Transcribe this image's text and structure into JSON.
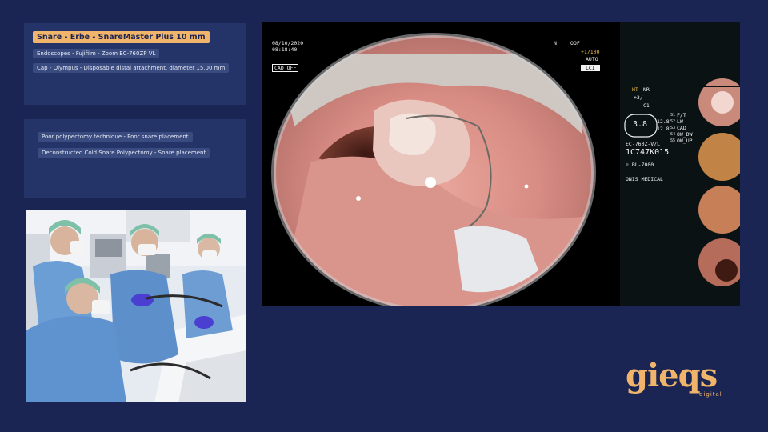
{
  "info": {
    "snare": "Snare - Erbe - SnareMaster Plus 10 mm",
    "endoscope": "Endoscopes - Fujifilm - Zoom EC-760ZP VL",
    "cap": "Cap - Olympus - Disposable distal attachment, diameter 15,00 mm"
  },
  "lesson": {
    "item1": "Poor polypectomy technique - Poor snare placement",
    "item2": "Deconstructed Cold Snare Polypectomy - Snare placement"
  },
  "osd": {
    "date": "08/10/2020",
    "time": "08:18:40",
    "cad": "CAD OFF",
    "n": "N",
    "oof": "OOF",
    "zoom": "+1/100",
    "auto": "AUTO",
    "mode": "LCI",
    "ht": "HT",
    "nr": "NR",
    "plus3": "+3/",
    "c1": "C1",
    "gauge": "3.8",
    "s1": "S1",
    "s1v": "F/T",
    "s2": "S2",
    "s2v": "LW",
    "s3": "S3",
    "s3v": "CAD",
    "s4": "S4",
    "s4v": "OW_DW",
    "s5": "S5",
    "s5v": "OW_UP",
    "n128a": "12.8",
    "n128b": "12.8",
    "scope": "EC-760Z-V/L",
    "serial": "1C747K015",
    "light": "BL-7000",
    "vendor": "ONIS MEDICAL"
  },
  "brand": {
    "name": "gieqs",
    "sub": "digital"
  }
}
